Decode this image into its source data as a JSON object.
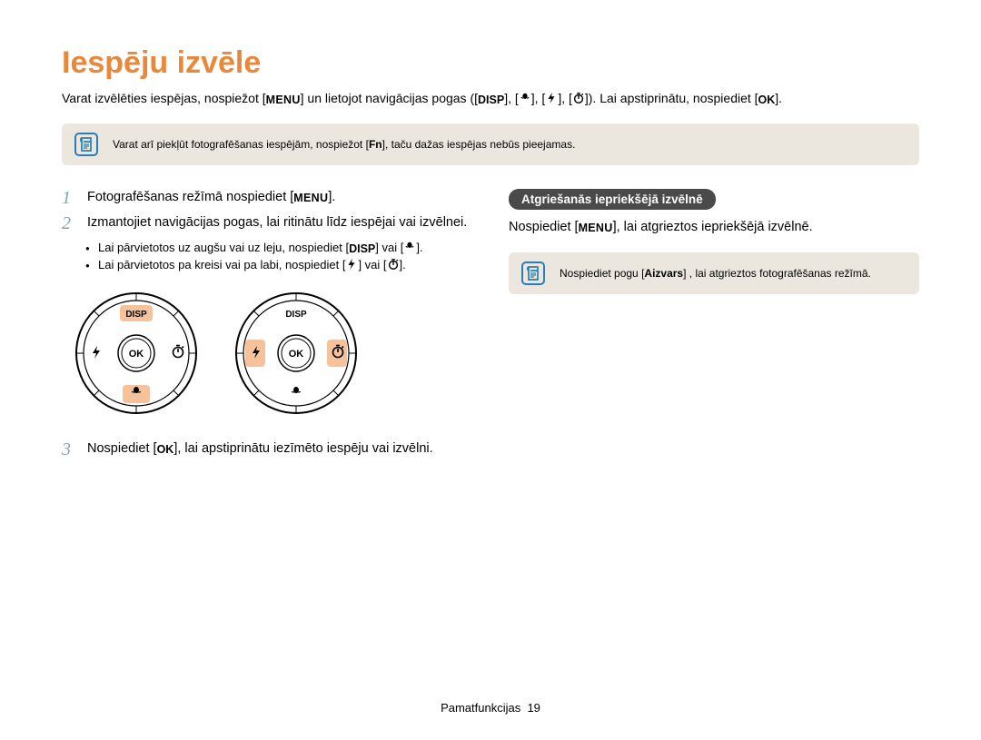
{
  "title": "Iespēju izvēle",
  "intro": {
    "part1": "Varat izvēlēties iespējas, nospiežot [",
    "menu": "MENU",
    "part2": "] un lietojot navigācijas pogas ([",
    "disp": "DISP",
    "part3": "], [",
    "part4": "], [",
    "part5": "], [",
    "part6": "]). Lai apstiprinātu, nospiediet [",
    "ok": "OK",
    "part7": "]."
  },
  "noteTop": {
    "pre": "Varat arī piekļūt fotografēšanas iespējām, nospiežot [",
    "fn": "Fn",
    "post": "], taču dažas iespējas nebūs pieejamas."
  },
  "steps": {
    "s1": {
      "num": "1",
      "pre": "Fotografēšanas režīmā nospiediet [",
      "btn": "MENU",
      "post": "]."
    },
    "s2": {
      "num": "2",
      "text": "Izmantojiet navigācijas pogas, lai ritinātu līdz iespējai vai izvēlnei."
    },
    "b1": {
      "pre": "Lai pārvietotos uz augšu vai uz leju, nospiediet [",
      "disp": "DISP",
      "mid": "] vai [",
      "post": "]."
    },
    "b2": {
      "pre": "Lai pārvietotos pa kreisi vai pa labi, nospiediet [",
      "mid": "] vai [",
      "post": "]."
    },
    "s3": {
      "num": "3",
      "pre": "Nospiediet [",
      "ok": "OK",
      "post": "], lai apstiprinātu iezīmēto iespēju vai izvēlni."
    }
  },
  "right": {
    "heading": "Atgriešanās iepriekšējā izvēlnē",
    "body_pre": "Nospiediet [",
    "body_menu": "MENU",
    "body_post": "], lai atgrieztos iepriekšējā izvēlnē.",
    "note_pre": "Nospiediet pogu [",
    "note_bold": "Aizvars",
    "note_post": "] , lai atgrieztos fotografēšanas režīmā."
  },
  "dial": {
    "ok": "OK",
    "disp": "DISP"
  },
  "footer": {
    "label": "Pamatfunkcijas",
    "page": "19"
  }
}
